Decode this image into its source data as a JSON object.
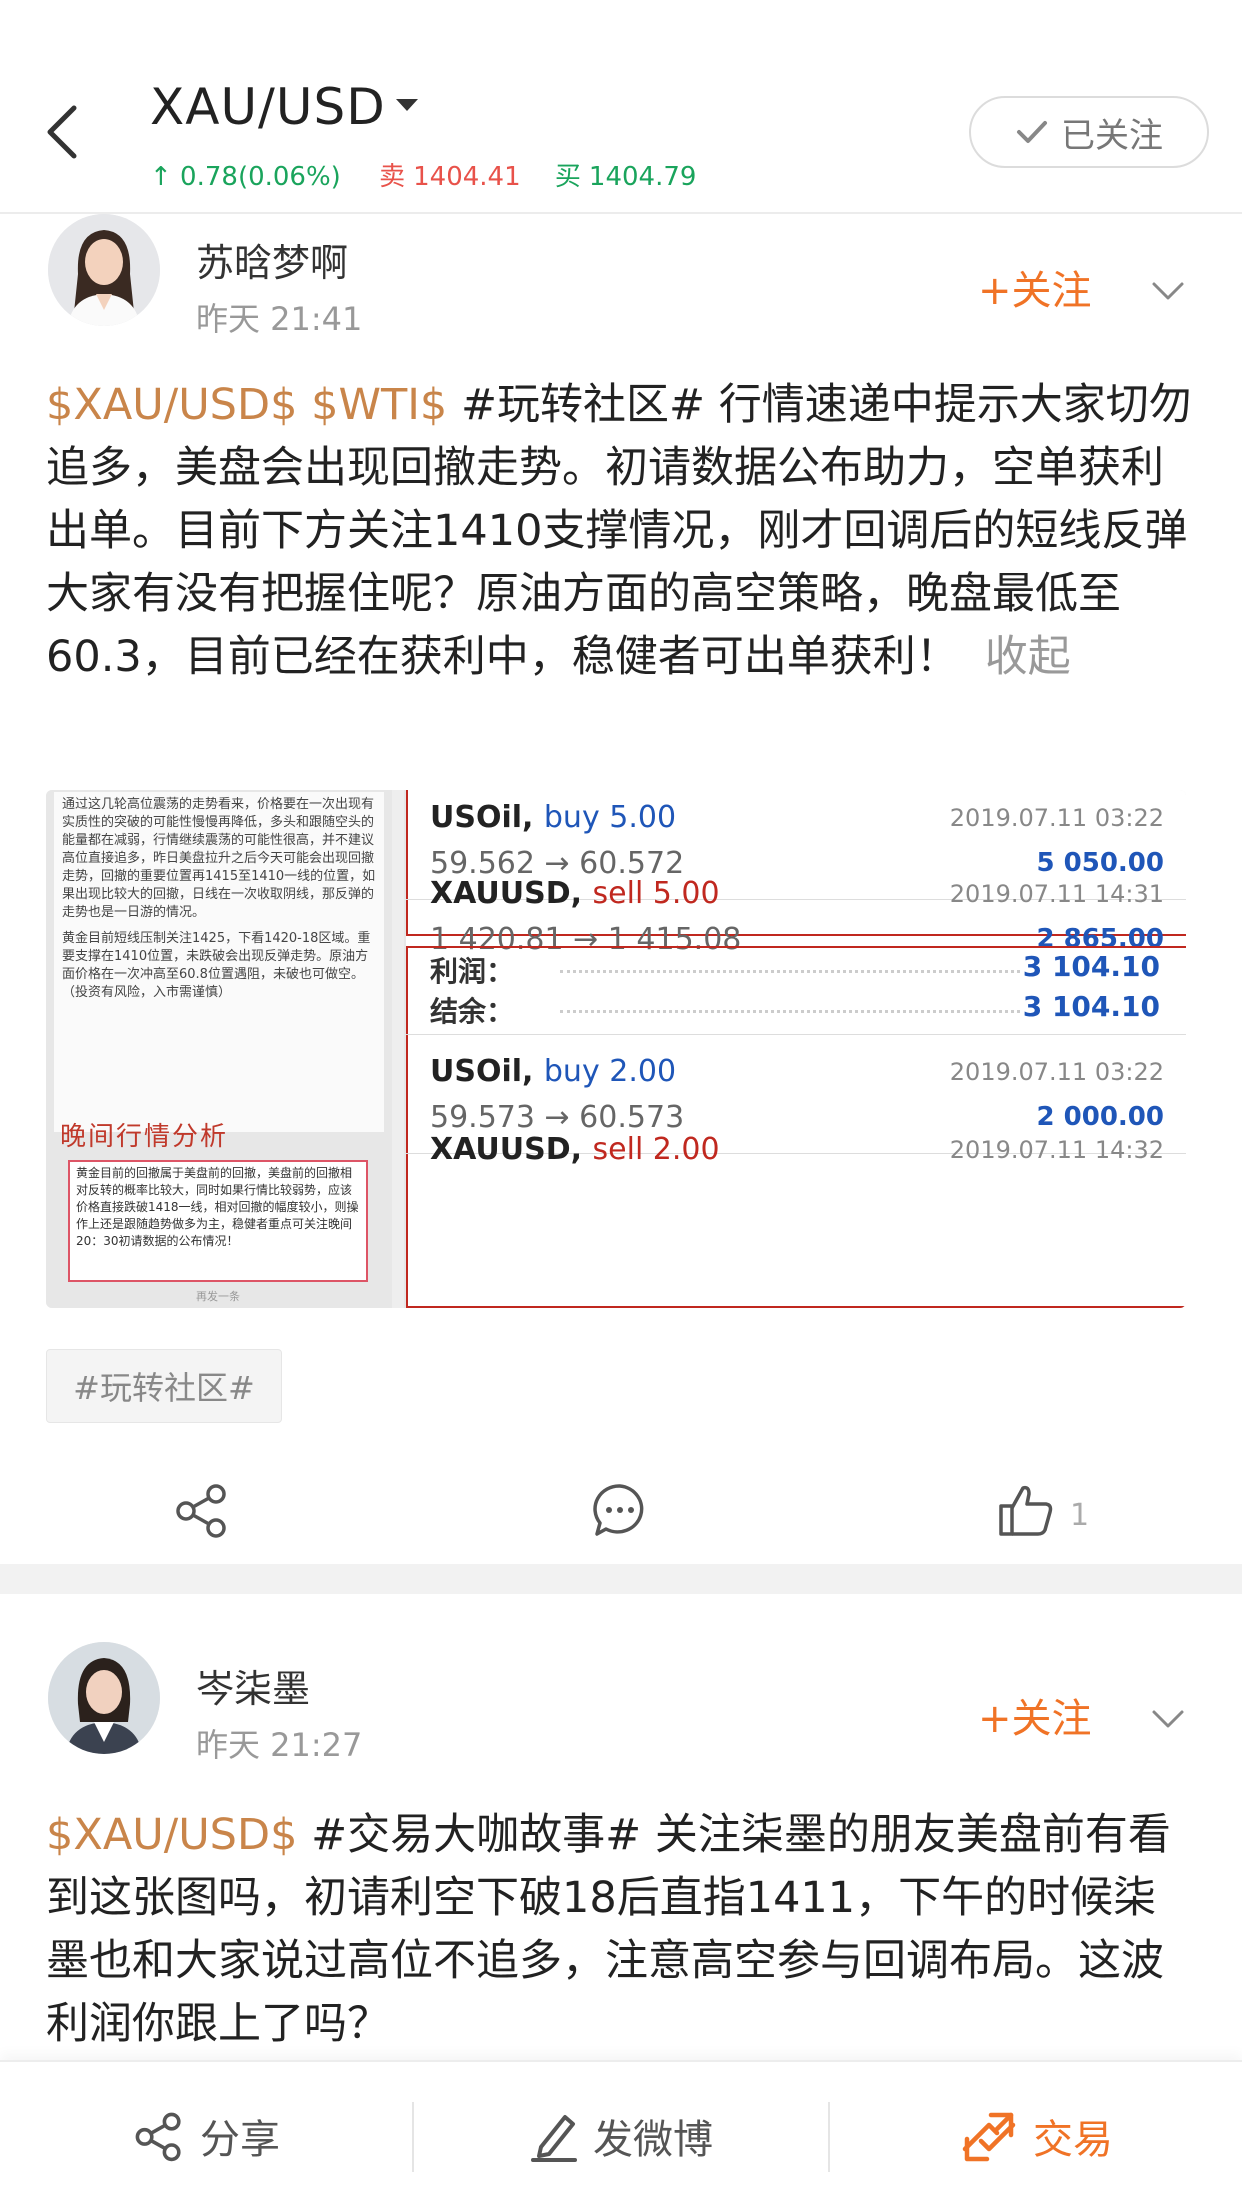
{
  "header": {
    "title": "XAU/USD",
    "change": "↑ 0.78(0.06%)",
    "sell_label": "卖",
    "sell_price": "1404.41",
    "buy_label": "买",
    "buy_price": "1404.79",
    "followed_label": "已关注"
  },
  "posts": [
    {
      "author": "苏晗梦啊",
      "time": "昨天 21:41",
      "follow_label": "关注",
      "tag1": "$XAU/USD$",
      "tag2": "$WTI$",
      "topic": "#玩转社区#",
      "body": "行情速递中提示大家切勿追多，美盘会出现回撤走势。初请数据公布助力，空单获利出单。目前下方关注1410支撑情况，刚才回调后的短线反弹大家有没有把握住呢？原油方面的高空策略，晚盘最低至60.3，目前已经在获利中，稳健者可出单获利！",
      "collapse_label": "收起",
      "topic_chip": "#玩转社区#",
      "like_count": "1",
      "image": {
        "note1": "通过这几轮高位震荡的走势看来，价格要在一次出现有实质性的突破的可能性慢慢再降低，多头和跟随空头的能量都在减弱，行情继续震荡的可能性很高，并不建议高位直接追多，昨日美盘拉升之后今天可能会出现回撤走势，回撤的重要位置再1415至1410一线的位置，如果出现比较大的回撤，日线在一次收取阴线，那反弹的走势也是一日游的情况。",
        "note1b": "黄金目前短线压制关注1425，下看1420-18区域。重要支撑在1410位置，未跌破会出现反弹走势。原油方面价格在一次冲高至60.8位置遇阻，未破也可做空。（投资有风险，入市需谨慎）",
        "note_title": "晚间行情分析",
        "note2": "黄金目前的回撤属于美盘前的回撤，美盘前的回撤相对反转的概率比较大，同时如果行情比较弱势，应该价格直接跌破1418一线，相对回撤的幅度较小，则操作上还是跟随趋势做多为主，稳健者重点可关注晚间20：30初请数据的公布情况！",
        "note_more": "再发一条",
        "trades": [
          {
            "sym": "USOil,",
            "side": "buy 5.00",
            "price": "59.562 → 60.572",
            "date": "2019.07.11 03:22",
            "profit": "5 050.00"
          },
          {
            "sym": "XAUUSD,",
            "side": "sell 5.00",
            "price": "1 420.81 → 1 415.08",
            "date": "2019.07.11 14:31",
            "profit": "2 865.00"
          }
        ],
        "profit_label": "利润：",
        "profit_value": "3 104.10",
        "balance_label": "结余：",
        "balance_value": "3 104.10",
        "trades2": [
          {
            "sym": "USOil,",
            "side": "buy 2.00",
            "price": "59.573 → 60.573",
            "date": "2019.07.11 03:22",
            "profit": "2 000.00"
          },
          {
            "sym": "XAUUSD,",
            "side": "sell 2.00",
            "price": "",
            "date": "2019.07.11 14:32",
            "profit": ""
          }
        ]
      }
    },
    {
      "author": "岑柒墨",
      "time": "昨天 21:27",
      "follow_label": "关注",
      "tag1": "$XAU/USD$",
      "topic": "#交易大咖故事#",
      "body": "关注柒墨的朋友美盘前有看到这张图吗，初请利空下破18后直指1411，下午的时候柒墨也和大家说过高位不追多，注意高空参与回调布局。这波利润你跟上了吗？"
    }
  ],
  "bottom_bar": {
    "share_label": "分享",
    "weibo_label": "发微博",
    "trade_label": "交易"
  },
  "colors": {
    "accent_orange": "#f07326",
    "tag_brown": "#c9854a",
    "up_green": "#1aa45c",
    "down_red": "#e8524a"
  }
}
